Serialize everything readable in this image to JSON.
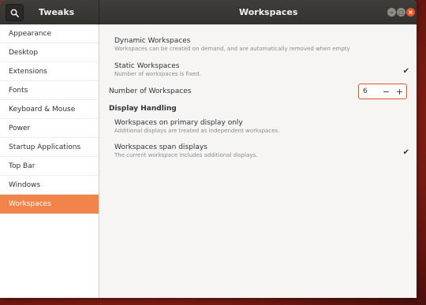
{
  "app": {
    "title": "Tweaks"
  },
  "page": {
    "title": "Workspaces"
  },
  "window_controls": {
    "minimize": "–",
    "maximize": "□",
    "close": "×"
  },
  "sidebar": {
    "items": [
      {
        "label": "Appearance"
      },
      {
        "label": "Desktop"
      },
      {
        "label": "Extensions"
      },
      {
        "label": "Fonts"
      },
      {
        "label": "Keyboard & Mouse"
      },
      {
        "label": "Power"
      },
      {
        "label": "Startup Applications"
      },
      {
        "label": "Top Bar"
      },
      {
        "label": "Windows"
      },
      {
        "label": "Workspaces",
        "selected": true
      }
    ]
  },
  "workspaces": {
    "dynamic": {
      "title": "Dynamic Workspaces",
      "subtitle": "Workspaces can be created on demand, and are automatically removed when empty",
      "checked": false
    },
    "static": {
      "title": "Static Workspaces",
      "subtitle": "Number of workspaces is fixed.",
      "checked": true,
      "check_mark": "✔"
    },
    "number": {
      "label": "Number of Workspaces",
      "value": "6",
      "minus": "−",
      "plus": "+"
    },
    "display_handling": {
      "heading": "Display Handling",
      "primary_only": {
        "title": "Workspaces on primary display only",
        "subtitle": "Additional displays are treated as independent workspaces.",
        "checked": false
      },
      "span": {
        "title": "Workspaces span displays",
        "subtitle": "The current workspace includes additional displays.",
        "checked": true,
        "check_mark": "✔"
      }
    }
  },
  "colors": {
    "accent": "#f0844a",
    "headerbar": "#3b3935",
    "close": "#e8562a"
  },
  "icons": {
    "search": "search-icon"
  }
}
